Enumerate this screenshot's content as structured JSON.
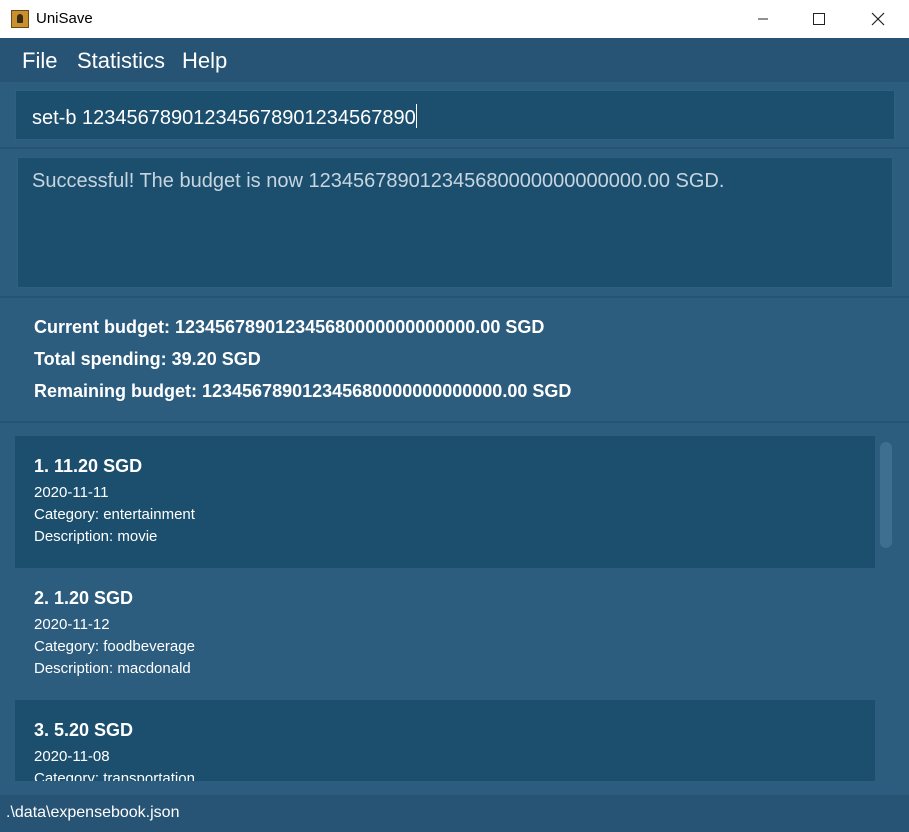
{
  "window": {
    "title": "UniSave",
    "controls": [
      "minimize-icon",
      "maximize-icon",
      "close-icon"
    ]
  },
  "menu": {
    "file": "File",
    "statistics": "Statistics",
    "help": "Help"
  },
  "command": {
    "value": "set-b 123456789012345678901234567890"
  },
  "result": {
    "message": "Successful! The budget is now 123456789012345680000000000000.00 SGD."
  },
  "summary": {
    "current_budget": "Current budget: 123456789012345680000000000000.00 SGD",
    "total_spending": "Total spending: 39.20 SGD",
    "remaining_budget": "Remaining budget: 123456789012345680000000000000.00 SGD"
  },
  "expenses": [
    {
      "title": "1.  11.20 SGD",
      "date": "2020-11-11",
      "category": "Category: entertainment",
      "description": "Description: movie"
    },
    {
      "title": "2.  1.20 SGD",
      "date": "2020-11-12",
      "category": "Category: foodbeverage",
      "description": "Description: macdonald"
    },
    {
      "title": "3.  5.20 SGD",
      "date": "2020-11-08",
      "category": "Category: transportation",
      "description": ""
    }
  ],
  "status": {
    "path": ".\\data\\expensebook.json"
  },
  "colors": {
    "background": "#2c5c7e",
    "panel_dark": "#1c4f6e",
    "menubar": "#275474",
    "text": "#ffffff"
  }
}
